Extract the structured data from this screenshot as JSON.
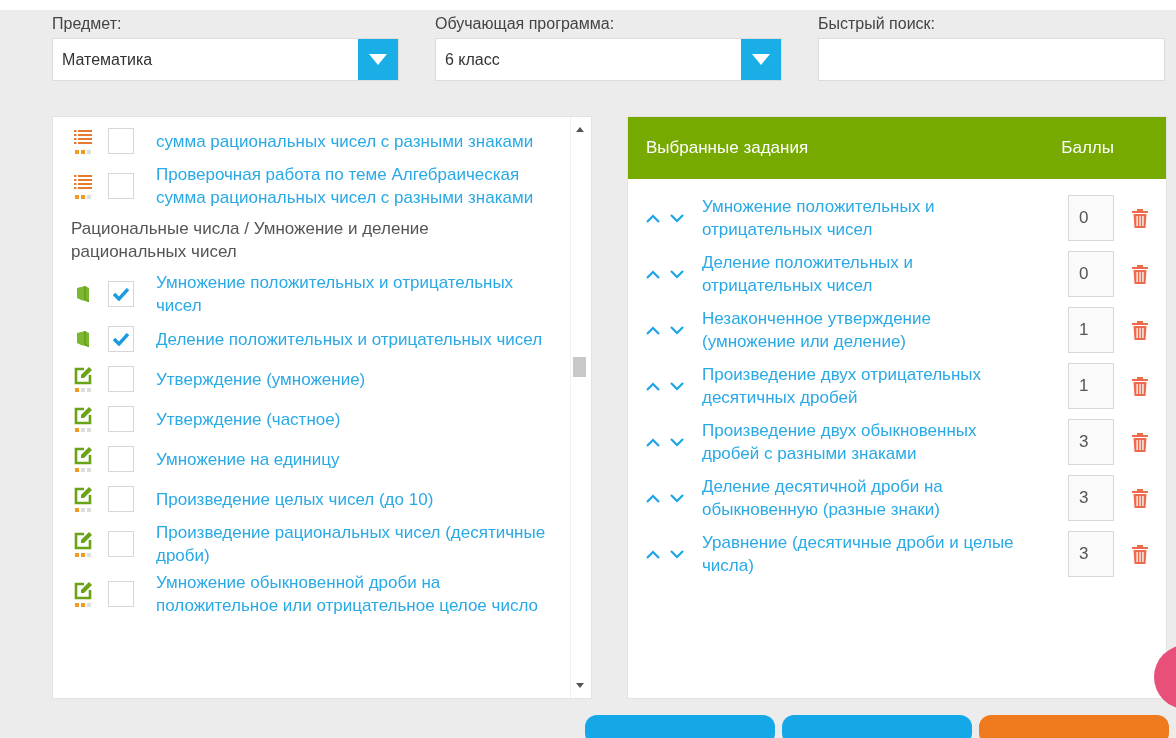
{
  "filters": [
    {
      "label": "Предмет:",
      "value": "Математика",
      "kind": "select"
    },
    {
      "label": "Обучающая программа:",
      "value": "6 класс",
      "kind": "select"
    },
    {
      "label": "Быстрый поиск:",
      "kind": "search"
    }
  ],
  "tasks": [
    {
      "kind": "list",
      "title": "сумма рациональных чисел с разными знаками",
      "checked": false,
      "stars": 2
    },
    {
      "kind": "list",
      "title": "Проверочная работа по теме Алгебраическая сумма рациональных чисел с разными знаками",
      "checked": false,
      "stars": 2
    },
    {
      "kind": "section",
      "title": "Рациональные числа / Умножение и деление рациональных чисел"
    },
    {
      "kind": "book",
      "title": "Умножение положительных и отрицательных чисел",
      "checked": true
    },
    {
      "kind": "book",
      "title": "Деление положительных и отрицательных чисел",
      "checked": true
    },
    {
      "kind": "edit",
      "title": "Утверждение (умножение)",
      "checked": false,
      "stars": 1
    },
    {
      "kind": "edit",
      "title": "Утверждение (частное)",
      "checked": false,
      "stars": 1
    },
    {
      "kind": "edit",
      "title": "Умножение на единицу",
      "checked": false,
      "stars": 1
    },
    {
      "kind": "edit",
      "title": "Произведение целых чисел (до 10)",
      "checked": false,
      "stars": 1
    },
    {
      "kind": "edit",
      "title": "Произведение рациональных чисел (десятичные дроби)",
      "checked": false,
      "stars": 2
    },
    {
      "kind": "edit",
      "title": "Умножение обыкновенной дроби на положительное или отрицательное целое число",
      "checked": false,
      "stars": 2
    }
  ],
  "selected": {
    "title": "Выбранные задания",
    "points_heading": "Баллы",
    "items": [
      {
        "title": "Умножение положительных и отрицательных чисел",
        "points": "0"
      },
      {
        "title": "Деление положительных и отрицательных чисел",
        "points": "0"
      },
      {
        "title": "Незаконченное утверждение (умножение или деление)",
        "points": "1"
      },
      {
        "title": "Произведение двух отрицательных десятичных дробей",
        "points": "1"
      },
      {
        "title": "Произведение двух обыкновенных дробей с разными знаками",
        "points": "3"
      },
      {
        "title": "Деление десятичной дроби на обыкновенную (разные знаки)",
        "points": "3"
      },
      {
        "title": "Уравнение (десятичные дроби и целые числа)",
        "points": "3"
      }
    ]
  },
  "bottom_buttons": [
    {
      "kind": "primary"
    },
    {
      "kind": "primary"
    },
    {
      "kind": "warning"
    }
  ]
}
